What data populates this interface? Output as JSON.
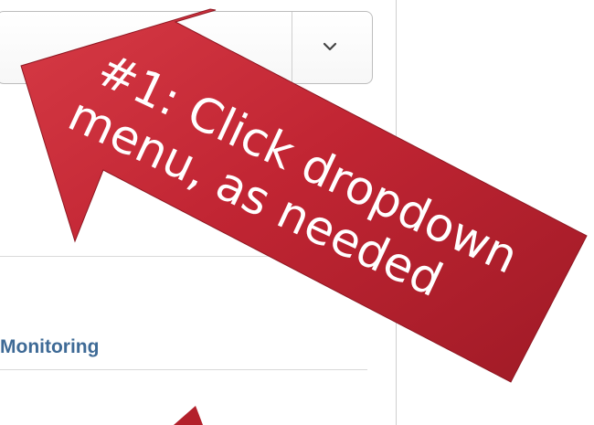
{
  "dropdown": {
    "selected_value": "",
    "icon": "chevron-down-icon"
  },
  "section": {
    "label": "Monitoring"
  },
  "callout": {
    "line1": "#1: Click dropdown",
    "line2": "menu, as needed",
    "color": "#b3202b"
  }
}
